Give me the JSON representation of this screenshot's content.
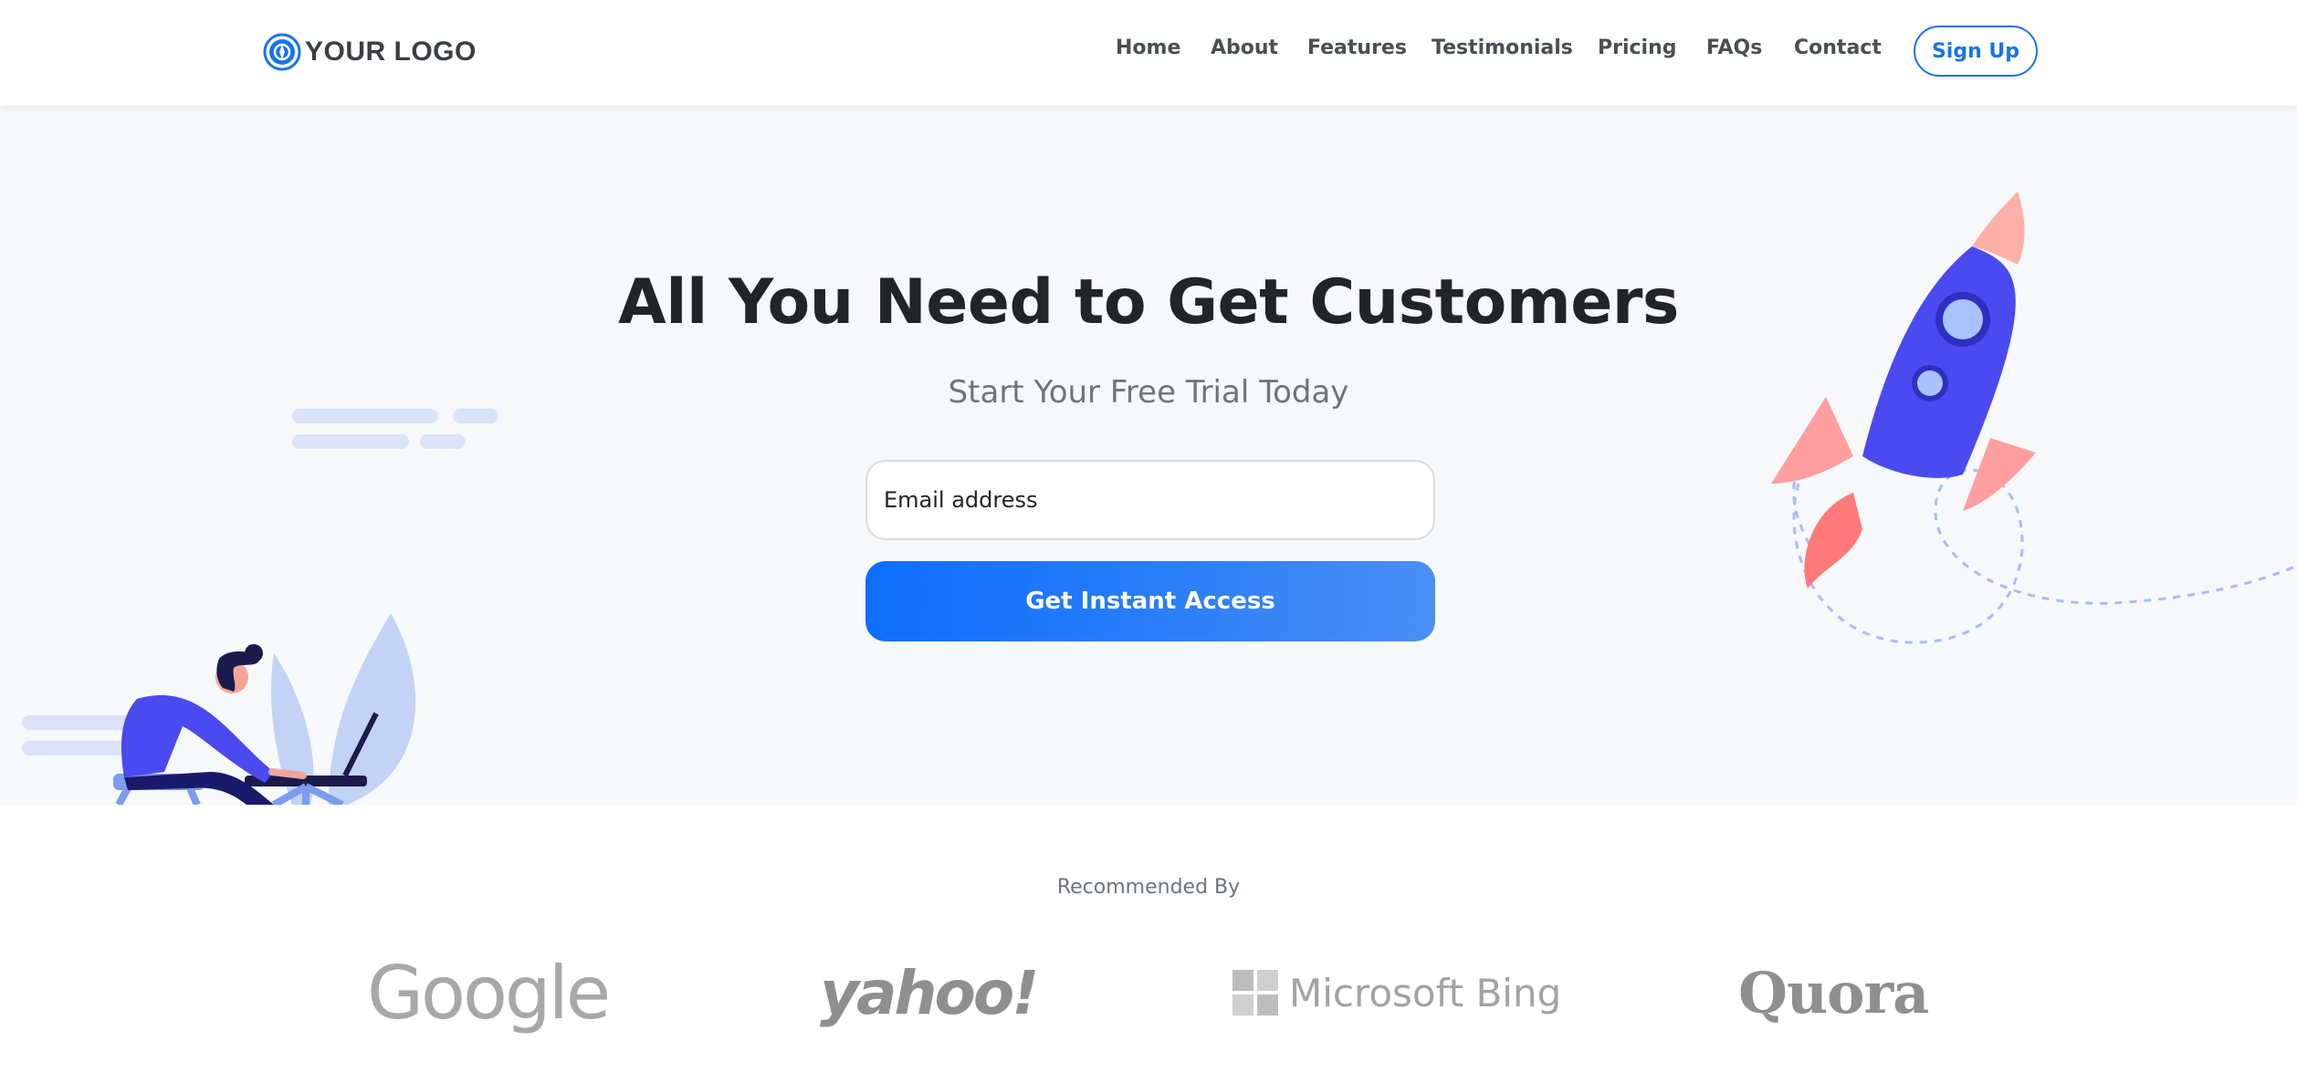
{
  "header": {
    "logo_text": "YOUR LOGO",
    "logo_icon": "compass-icon",
    "nav": [
      {
        "label": "Home"
      },
      {
        "label": "About"
      },
      {
        "label": "Features"
      },
      {
        "label": "Testimonials"
      },
      {
        "label": "Pricing"
      },
      {
        "label": "FAQs"
      },
      {
        "label": "Contact"
      }
    ],
    "signup_label": "Sign Up"
  },
  "hero": {
    "title": "All You Need to Get Customers",
    "subtitle": "Start Your Free Trial Today",
    "email_placeholder": "Email address",
    "cta_label": "Get Instant Access"
  },
  "recommended": {
    "label": "Recommended By",
    "brands": [
      "Google",
      "yahoo!",
      "Microsoft Bing",
      "Quora"
    ]
  },
  "colors": {
    "accent": "#1a73e8",
    "hero_bg": "#f7f8fa",
    "brand_gray": "#9a9a9a"
  }
}
